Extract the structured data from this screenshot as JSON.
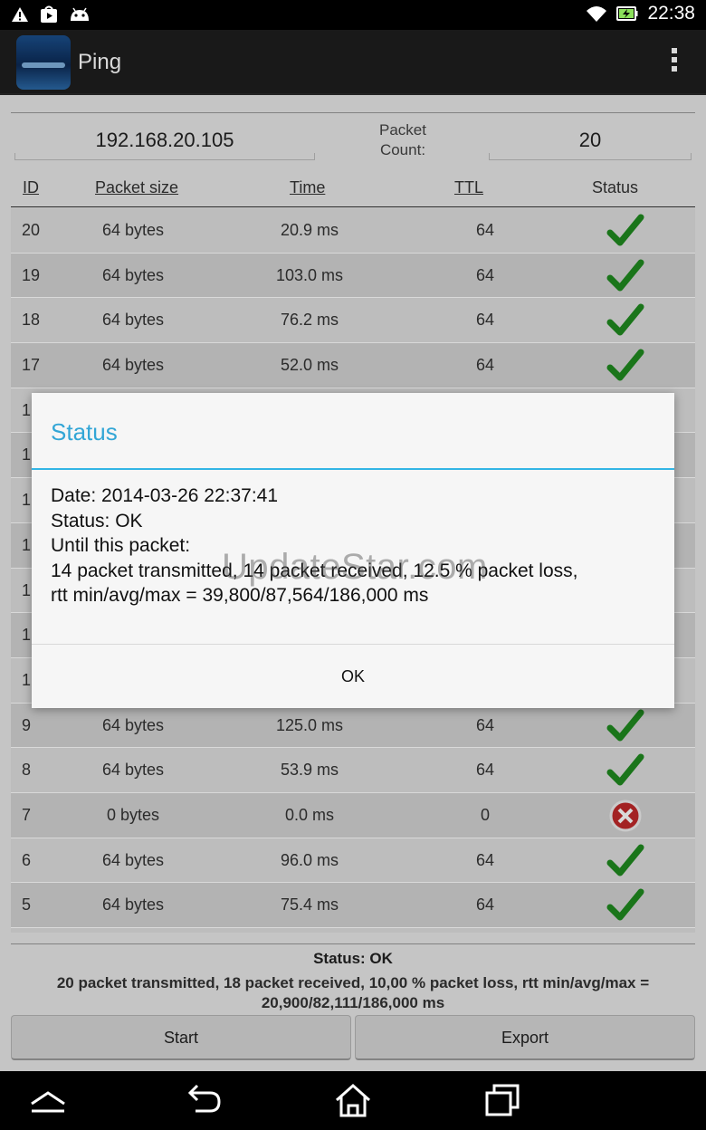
{
  "statusbar": {
    "time": "22:38"
  },
  "app": {
    "title": "Ping"
  },
  "form": {
    "ip": "192.168.20.105",
    "packet_count_label_line1": "Packet",
    "packet_count_label_line2": "Count:",
    "packet_count": "20"
  },
  "table": {
    "headers": {
      "id": "ID",
      "size": "Packet size",
      "time": "Time",
      "ttl": "TTL",
      "status": "Status"
    },
    "rows": [
      {
        "id": "20",
        "size": "64 bytes",
        "time": "20.9 ms",
        "ttl": "64",
        "status": "ok"
      },
      {
        "id": "19",
        "size": "64 bytes",
        "time": "103.0 ms",
        "ttl": "64",
        "status": "ok"
      },
      {
        "id": "18",
        "size": "64 bytes",
        "time": "76.2 ms",
        "ttl": "64",
        "status": "ok"
      },
      {
        "id": "17",
        "size": "64 bytes",
        "time": "52.0 ms",
        "ttl": "64",
        "status": "ok"
      },
      {
        "id": "1",
        "size": "",
        "time": "",
        "ttl": "",
        "status": "ok"
      },
      {
        "id": "1",
        "size": "",
        "time": "",
        "ttl": "",
        "status": "ok"
      },
      {
        "id": "1",
        "size": "",
        "time": "",
        "ttl": "",
        "status": "ok"
      },
      {
        "id": "1",
        "size": "",
        "time": "",
        "ttl": "",
        "status": "ok"
      },
      {
        "id": "1",
        "size": "",
        "time": "",
        "ttl": "",
        "status": "ok"
      },
      {
        "id": "1",
        "size": "",
        "time": "",
        "ttl": "",
        "status": "ok"
      },
      {
        "id": "1",
        "size": "",
        "time": "",
        "ttl": "",
        "status": "ok"
      },
      {
        "id": "9",
        "size": "64 bytes",
        "time": "125.0 ms",
        "ttl": "64",
        "status": "ok"
      },
      {
        "id": "8",
        "size": "64 bytes",
        "time": "53.9 ms",
        "ttl": "64",
        "status": "ok"
      },
      {
        "id": "7",
        "size": "0 bytes",
        "time": "0.0 ms",
        "ttl": "0",
        "status": "fail"
      },
      {
        "id": "6",
        "size": "64 bytes",
        "time": "96.0 ms",
        "ttl": "64",
        "status": "ok"
      },
      {
        "id": "5",
        "size": "64 bytes",
        "time": "75.4 ms",
        "ttl": "64",
        "status": "ok"
      },
      {
        "id": "",
        "size": "",
        "time": "",
        "ttl": "",
        "status": "ok"
      }
    ]
  },
  "summary": {
    "title": "Status: OK",
    "text": "20 packet transmitted, 18 packet received, 10,00 % packet loss, rtt min/avg/max = 20,900/82,111/186,000 ms"
  },
  "buttons": {
    "start": "Start",
    "export": "Export"
  },
  "dialog": {
    "title": "Status",
    "date": "Date: 2014-03-26 22:37:41",
    "status": "Status: OK",
    "until": "Until this packet:",
    "line1": "14 packet transmitted, 14 packet received, 12.5 % packet loss,",
    "line2": "rtt min/avg/max = 39,800/87,564/186,000 ms",
    "ok": "OK"
  },
  "watermark": "UpdateStar.com",
  "colors": {
    "accent": "#33b5e5",
    "ok": "#1f8a1f",
    "fail": "#c0282a"
  }
}
